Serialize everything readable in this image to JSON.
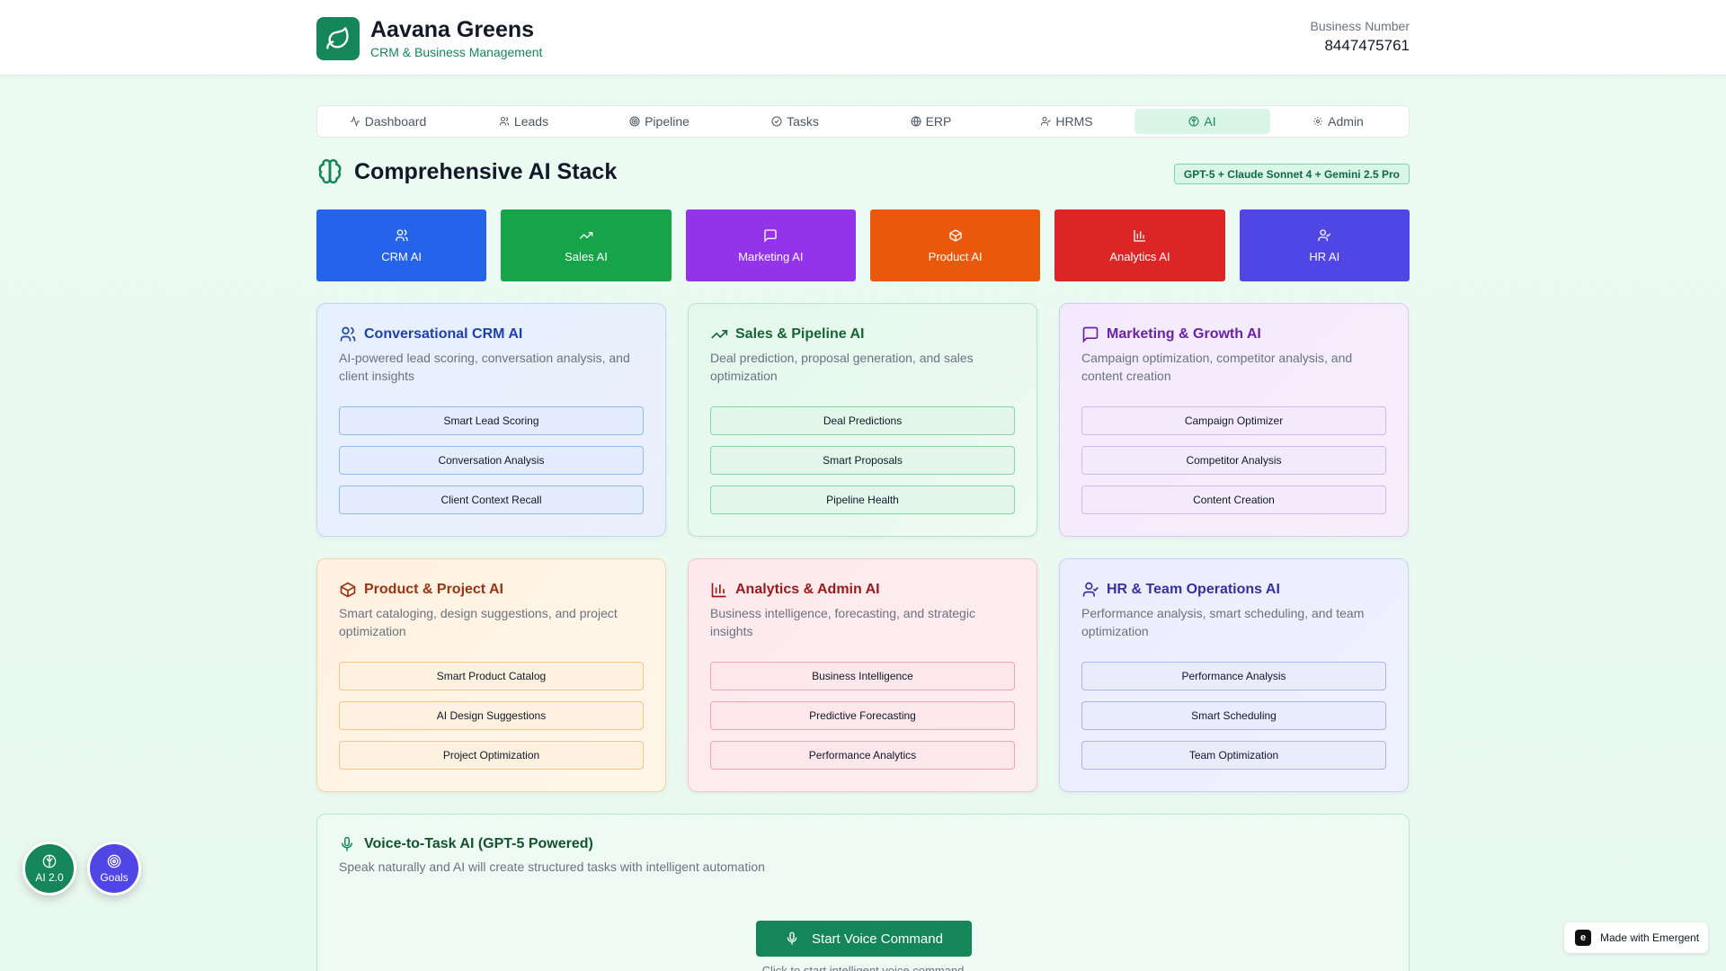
{
  "header": {
    "brand_name": "Aavana Greens",
    "brand_subtitle": "CRM & Business Management",
    "business_label": "Business Number",
    "business_number": "8447475761"
  },
  "nav": {
    "items": [
      {
        "label": "Dashboard",
        "icon": "activity-icon"
      },
      {
        "label": "Leads",
        "icon": "users-icon"
      },
      {
        "label": "Pipeline",
        "icon": "target-icon"
      },
      {
        "label": "Tasks",
        "icon": "check-circle-icon"
      },
      {
        "label": "ERP",
        "icon": "globe-icon"
      },
      {
        "label": "HRMS",
        "icon": "user-icon"
      },
      {
        "label": "AI",
        "icon": "brain-icon",
        "active": true
      },
      {
        "label": "Admin",
        "icon": "gear-icon"
      }
    ]
  },
  "section": {
    "title": "Comprehensive AI Stack",
    "badge": "GPT-5 + Claude Sonnet 4 + Gemini 2.5 Pro"
  },
  "tiles": [
    {
      "label": "CRM AI",
      "color": "#2563eb",
      "icon": "users-icon"
    },
    {
      "label": "Sales AI",
      "color": "#16a34a",
      "icon": "trending-up-icon"
    },
    {
      "label": "Marketing AI",
      "color": "#9333ea",
      "icon": "message-icon"
    },
    {
      "label": "Product AI",
      "color": "#ea580c",
      "icon": "package-icon"
    },
    {
      "label": "Analytics AI",
      "color": "#dc2626",
      "icon": "bar-chart-icon"
    },
    {
      "label": "HR AI",
      "color": "#4f46e5",
      "icon": "user-check-icon"
    }
  ],
  "cards": [
    {
      "title": "Conversational CRM AI",
      "desc": "AI-powered lead scoring, conversation analysis, and client insights",
      "buttons": [
        "Smart Lead Scoring",
        "Conversation Analysis",
        "Client Context Recall"
      ]
    },
    {
      "title": "Sales & Pipeline AI",
      "desc": "Deal prediction, proposal generation, and sales optimization",
      "buttons": [
        "Deal Predictions",
        "Smart Proposals",
        "Pipeline Health"
      ]
    },
    {
      "title": "Marketing & Growth AI",
      "desc": "Campaign optimization, competitor analysis, and content creation",
      "buttons": [
        "Campaign Optimizer",
        "Competitor Analysis",
        "Content Creation"
      ]
    },
    {
      "title": "Product & Project AI",
      "desc": "Smart cataloging, design suggestions, and project optimization",
      "buttons": [
        "Smart Product Catalog",
        "AI Design Suggestions",
        "Project Optimization"
      ]
    },
    {
      "title": "Analytics & Admin AI",
      "desc": "Business intelligence, forecasting, and strategic insights",
      "buttons": [
        "Business Intelligence",
        "Predictive Forecasting",
        "Performance Analytics"
      ]
    },
    {
      "title": "HR & Team Operations AI",
      "desc": "Performance analysis, smart scheduling, and team optimization",
      "buttons": [
        "Performance Analysis",
        "Smart Scheduling",
        "Team Optimization"
      ]
    }
  ],
  "voice": {
    "title": "Voice-to-Task AI (GPT-5 Powered)",
    "desc": "Speak naturally and AI will create structured tasks with intelligent automation",
    "button": "Start Voice Command",
    "hint": "Click to start intelligent voice command"
  },
  "floating": {
    "ai_label": "AI 2.0",
    "goals_label": "Goals",
    "made_with": "Made with Emergent"
  }
}
